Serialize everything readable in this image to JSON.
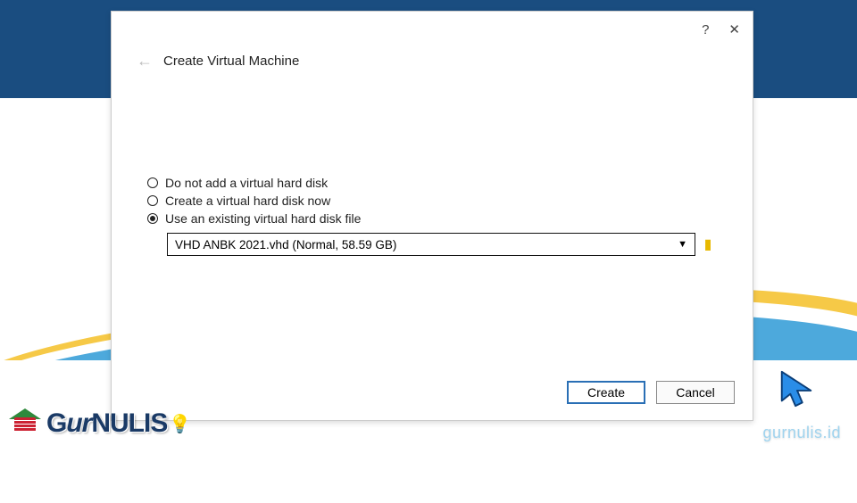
{
  "dialog": {
    "title": "Create Virtual Machine",
    "help_symbol": "?",
    "close_symbol": "✕",
    "back_symbol": "←"
  },
  "radios": {
    "opt1": "Do not add a virtual hard disk",
    "opt2": "Create a virtual hard disk now",
    "opt3": "Use an existing virtual hard disk file"
  },
  "dropdown": {
    "selected": "VHD ANBK 2021.vhd (Normal, 58.59 GB)",
    "caret": "▼",
    "folder": "▮"
  },
  "buttons": {
    "create": "Create",
    "cancel": "Cancel"
  },
  "watermark": "gurnulis.id",
  "logo": {
    "text_part1": "G",
    "text_part2": "ur",
    "text_part3": "NULIS"
  }
}
